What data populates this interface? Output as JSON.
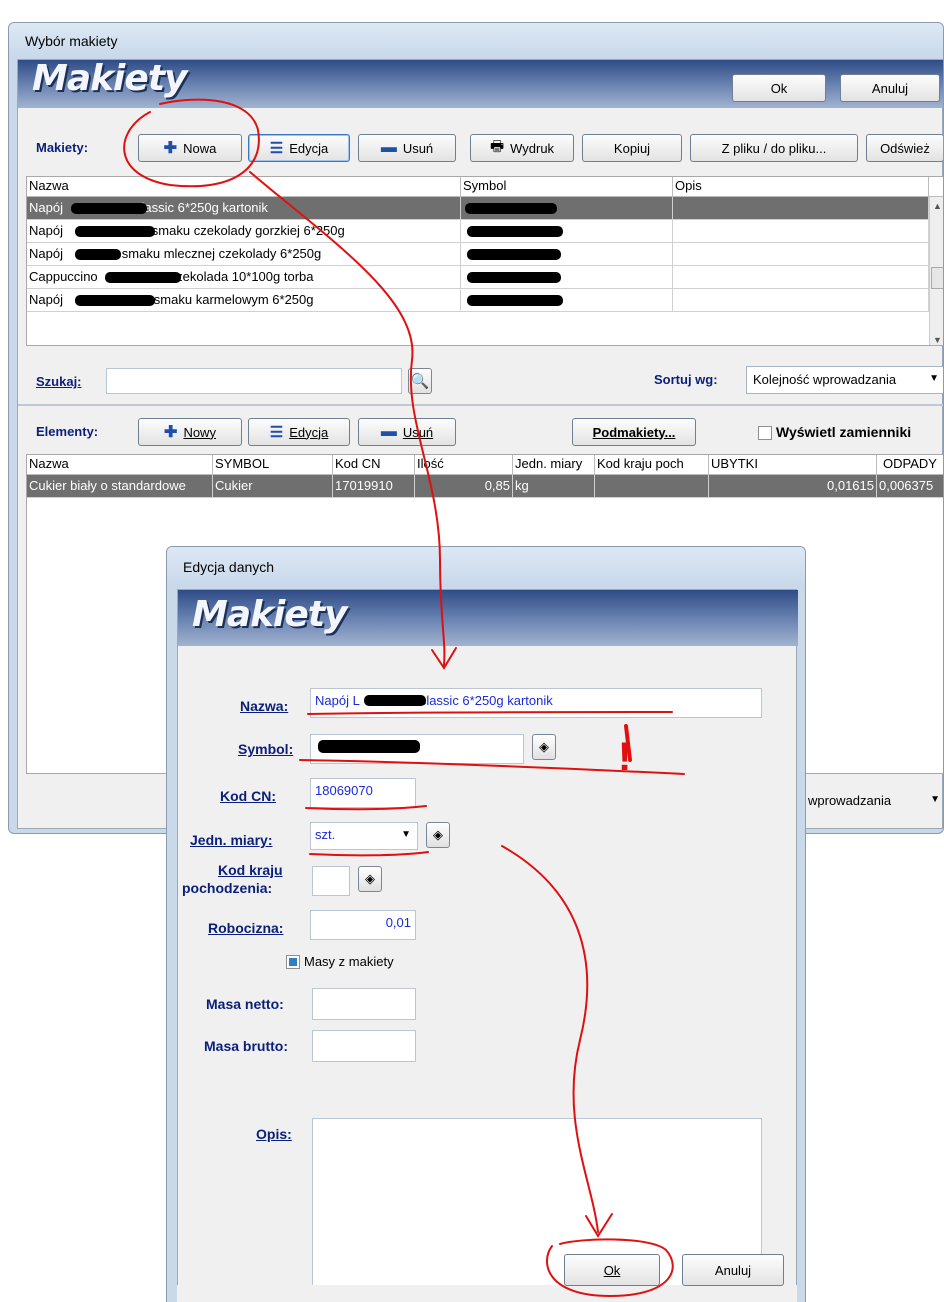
{
  "main_window": {
    "title": "Wybór makiety",
    "banner_title": "Makiety",
    "ok_label": "Ok",
    "cancel_label": "Anuluj",
    "makiety_section_label": "Makiety:",
    "toolbar": {
      "new_label": "Nowa",
      "edit_label": "Edycja",
      "delete_label": "Usuń",
      "print_label": "Wydruk",
      "copy_label": "Kopiuj",
      "file_label": "Z pliku / do pliku...",
      "refresh_label": "Odśwież"
    },
    "makiety_table": {
      "columns": [
        "Nazwa",
        "Symbol",
        "Opis"
      ],
      "rows": [
        {
          "name_prefix": "Napój",
          "name_suffix": "classic 6*250g kartonik",
          "selected": true
        },
        {
          "name_prefix": "Napój",
          "name_suffix": "o smaku czekolady gorzkiej 6*250g",
          "selected": false
        },
        {
          "name_prefix": "Napój",
          "name_suffix": "o smaku mlecznej czekolady 6*250g",
          "selected": false
        },
        {
          "name_prefix": "Cappuccino",
          "name_suffix": "czekolada 10*100g torba",
          "selected": false
        },
        {
          "name_prefix": "Napój",
          "name_suffix": "o smaku karmelowym 6*250g",
          "selected": false
        }
      ]
    },
    "search_label": "Szukaj:",
    "search_value": "",
    "sort_label": "Sortuj wg:",
    "sort_value": "Kolejność wprowadzania",
    "elements_section_label": "Elementy:",
    "elements_toolbar": {
      "new_label": "Nowy",
      "edit_label": "Edycja",
      "delete_label": "Usuń",
      "submodels_label": "Podmakiety...",
      "show_substitutes_label": "Wyświetl zamienniki",
      "show_substitutes_checked": false
    },
    "elements_table": {
      "columns": [
        "Nazwa",
        "SYMBOL",
        "Kod CN",
        "Ilość",
        "Jedn. miary",
        "Kod kraju poch",
        "UBYTKI",
        "ODPADY"
      ],
      "rows": [
        [
          "Cukier biały o standardowe",
          "Cukier",
          "17019910",
          "0,85",
          "kg",
          "",
          "0,01615",
          "0,006375"
        ]
      ]
    },
    "bottom_sort_value": "wprowadzania"
  },
  "dialog": {
    "title": "Edycja danych",
    "banner_title": "Makiety",
    "fields": {
      "name_label": "Nazwa:",
      "name_value_prefix": "Napój L",
      "name_value_suffix": "classic 6*250g kartonik",
      "symbol_label": "Symbol:",
      "kod_cn_label": "Kod CN:",
      "kod_cn_value": "18069070",
      "unit_label": "Jedn. miary:",
      "unit_value": "szt.",
      "country_label_line1": "Kod kraju",
      "country_label_line2": "pochodzenia:",
      "labor_label": "Robocizna:",
      "labor_value": "0,01",
      "masses_from_model_label": "Masy z makiety",
      "masses_from_model_checked": true,
      "net_mass_label": "Masa netto:",
      "gross_mass_label": "Masa brutto:",
      "description_label": "Opis:"
    },
    "ok_label": "Ok",
    "cancel_label": "Anuluj"
  },
  "annotations": {
    "exclamation": "!"
  },
  "colors": {
    "banner_dark": "#2f4c86",
    "selected_row": "#6f6f6f",
    "annotation_red": "#e01010",
    "label_blue": "#0a1f7a",
    "value_blue": "#1a2ad8"
  }
}
